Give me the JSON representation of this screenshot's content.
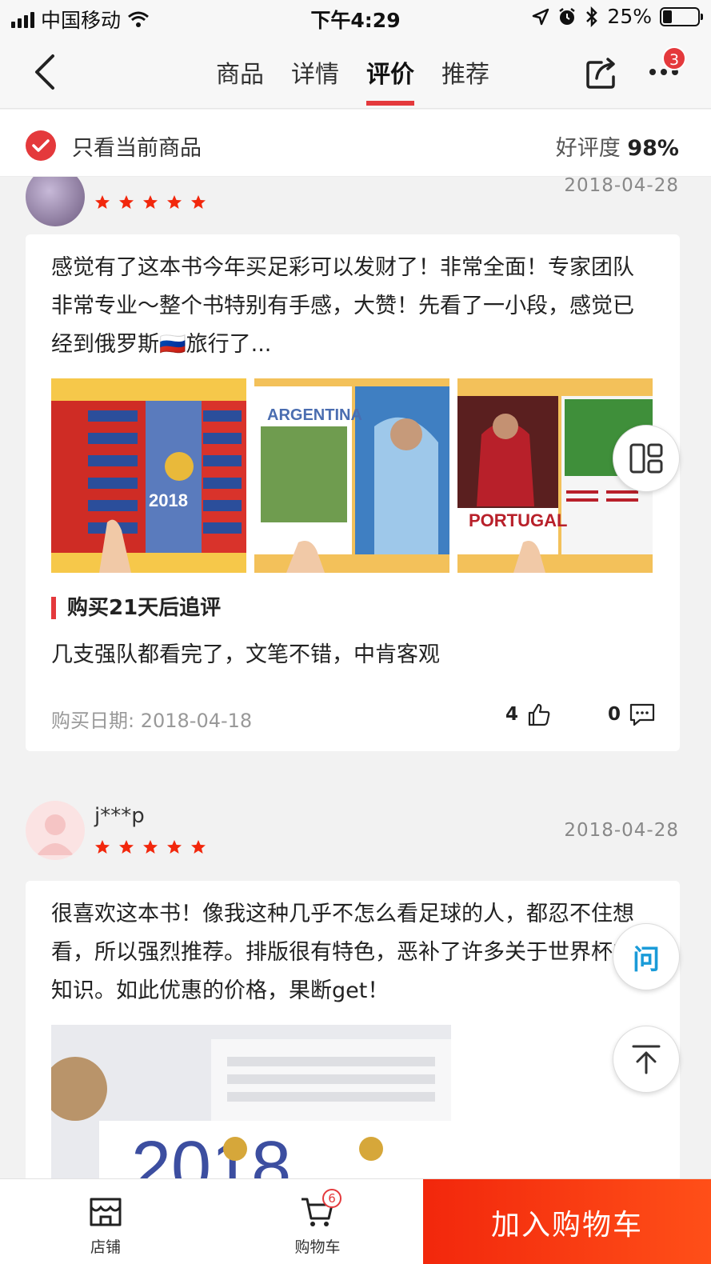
{
  "status_bar": {
    "carrier": "中国移动",
    "time": "下午4:29",
    "battery": "25%",
    "battery_level": 0.25
  },
  "nav": {
    "tabs": [
      {
        "label": "商品",
        "active": false
      },
      {
        "label": "详情",
        "active": false
      },
      {
        "label": "评价",
        "active": true
      },
      {
        "label": "推荐",
        "active": false
      }
    ],
    "more_badge": "3"
  },
  "filter": {
    "only_current_label": "只看当前商品",
    "rating_label": "好评度",
    "rating_value": "98%"
  },
  "reviews": [
    {
      "username": "",
      "date": "2018-04-28",
      "stars": 5,
      "text": "感觉有了这本书今年买足彩可以发财了！非常全面！专家团队非常专业～整个书特别有手感，大赞！先看了一小段，感觉已经到俄罗斯🇷🇺旅行了...",
      "images": [
        {
          "caption": "2018"
        },
        {
          "caption": "ARGENTINA"
        },
        {
          "caption": "PORTUGAL"
        }
      ],
      "followup_title": "购买21天后追评",
      "followup_text": "几支强队都看完了，文笔不错，中肯客观",
      "purchase_date": "购买日期: 2018-04-18",
      "likes": "4",
      "comments": "0"
    },
    {
      "username": "j***p",
      "date": "2018-04-28",
      "stars": 5,
      "text": "很喜欢这本书！像我这种几乎不怎么看足球的人，都忍不住想看，所以强烈推荐。排版很有特色，恶补了许多关于世界杯的知识。如此优惠的价格，果断get！",
      "images": [
        {
          "caption": "2018"
        }
      ]
    }
  ],
  "floating": {
    "ask_label": "问"
  },
  "bottom_bar": {
    "shop_label": "店铺",
    "cart_label": "购物车",
    "cart_badge": "6",
    "add_to_cart": "加入购物车"
  },
  "colors": {
    "accent": "#e4393c",
    "cta": "#f2270c",
    "star": "#f2270c",
    "ask": "#1a9bd8"
  }
}
